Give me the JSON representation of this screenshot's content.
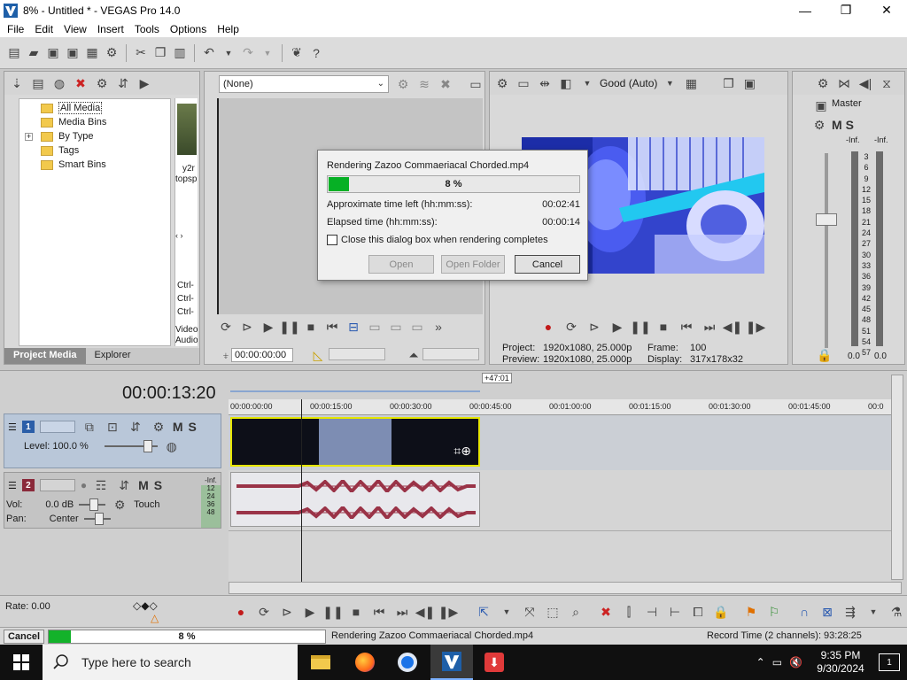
{
  "window": {
    "title": "8% - Untitled * - VEGAS Pro 14.0",
    "minimize": "—",
    "maximize": "❐",
    "close": "✕"
  },
  "menu": [
    "File",
    "Edit",
    "View",
    "Insert",
    "Tools",
    "Options",
    "Help"
  ],
  "project_media": {
    "tree": [
      "All Media",
      "Media Bins",
      "By Type",
      "Tags",
      "Smart Bins"
    ],
    "tabs": [
      "Project Media",
      "Explorer"
    ],
    "thumb_labels": [
      "y2r",
      "topsp"
    ],
    "side_labels": [
      "Ctrl-",
      "Ctrl-",
      "Ctrl-",
      "Video:",
      "Audio:"
    ]
  },
  "trimmer": {
    "select_value": "(None)",
    "time": "00:00:00:00"
  },
  "preview": {
    "quality": "Good (Auto)",
    "project_label": "Project:",
    "project_value": "1920x1080, 25.000p",
    "preview_label": "Preview:",
    "preview_value": "1920x1080, 25.000p",
    "frame_label": "Frame:",
    "frame_value": "100",
    "display_label": "Display:",
    "display_value": "317x178x32"
  },
  "master": {
    "title": "Master",
    "inf_left": "-Inf.",
    "inf_right": "-Inf.",
    "scale": [
      "3",
      "6",
      "9",
      "12",
      "15",
      "18",
      "21",
      "24",
      "27",
      "30",
      "33",
      "36",
      "39",
      "42",
      "45",
      "48",
      "51",
      "54",
      "57"
    ],
    "db_left": "0.0",
    "db_right": "0.0"
  },
  "timeline": {
    "timecode": "00:00:13:20",
    "loop_length": "+47:01",
    "ruler": [
      "00:00:00:00",
      "00:00:15:00",
      "00:00:30:00",
      "00:00:45:00",
      "00:01:00:00",
      "00:01:15:00",
      "00:01:30:00",
      "00:01:45:00",
      "00:0"
    ],
    "video_track": {
      "number": "1",
      "level": "Level: 100.0 %"
    },
    "audio_track": {
      "number": "2",
      "vol_label": "Vol:",
      "vol_value": "0.0 dB",
      "pan_label": "Pan:",
      "pan_value": "Center",
      "mode": "Touch",
      "meter_inf": "-Inf.",
      "meter_marks": [
        "12",
        "24",
        "36",
        "48"
      ]
    },
    "rate": "Rate: 0.00"
  },
  "status": {
    "cancel": "Cancel",
    "percent": "8 %",
    "progress": 0.08,
    "text": "Rendering Zazoo Commaeriacal Chorded.mp4",
    "record": "Record Time (2 channels): 93:28:25"
  },
  "dialog": {
    "title": "Rendering Zazoo Commaeriacal Chorded.mp4",
    "percent": "8 %",
    "progress": 0.08,
    "time_left_label": "Approximate time left (hh:mm:ss):",
    "time_left_value": "00:02:41",
    "elapsed_label": "Elapsed time (hh:mm:ss):",
    "elapsed_value": "00:00:14",
    "checkbox_label": "Close this dialog box when rendering completes",
    "btn_open": "Open",
    "btn_open_folder": "Open Folder",
    "btn_cancel": "Cancel"
  },
  "taskbar": {
    "search_placeholder": "Type here to search",
    "time": "9:35 PM",
    "date": "9/30/2024",
    "notifications": "1"
  },
  "colors": {
    "progress_green": "#06b025",
    "track_blue": "#b9c7d9",
    "audio_wave": "#9a3347",
    "preview_blue": "#3a4fd8"
  }
}
